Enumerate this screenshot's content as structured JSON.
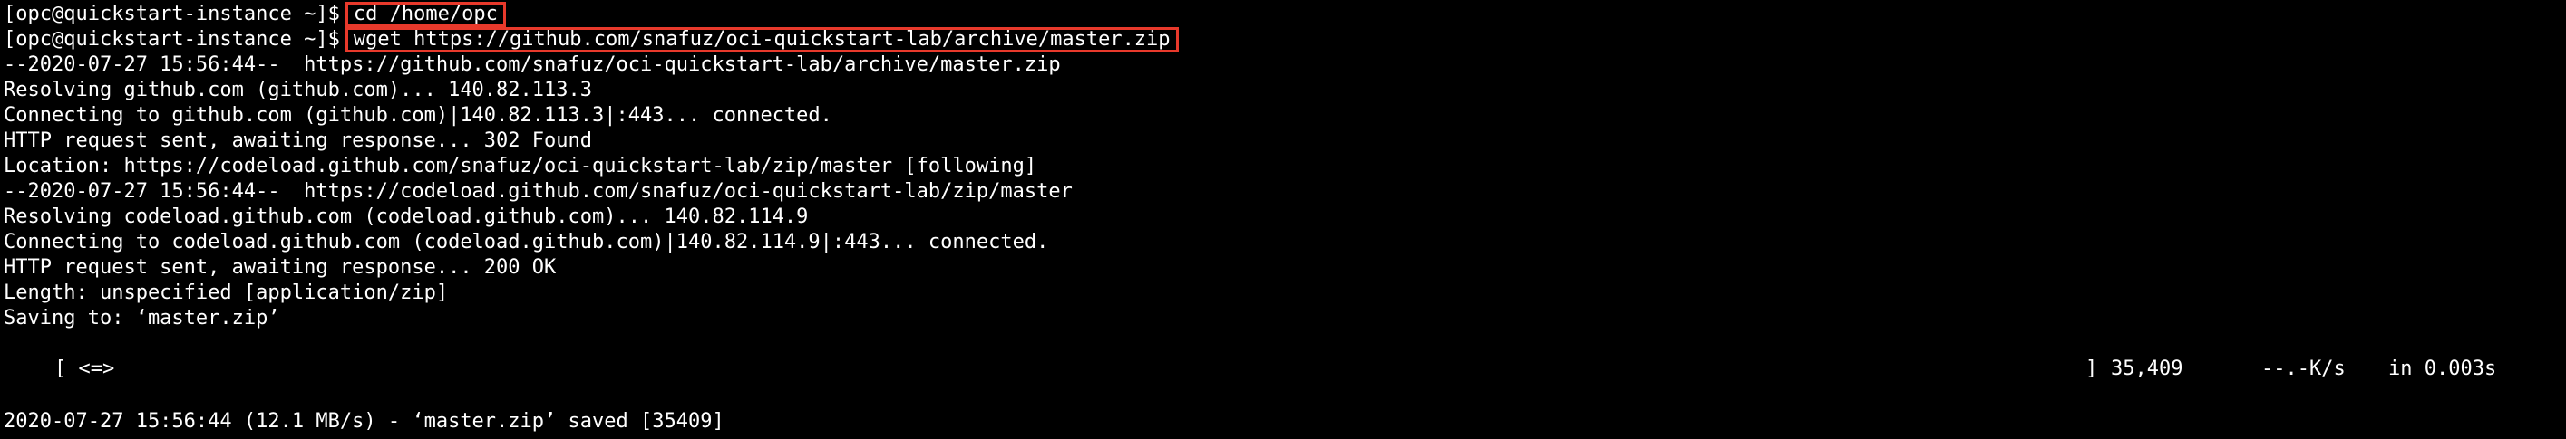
{
  "prompt": "[opc@quickstart-instance ~]$",
  "commands": [
    "cd /home/opc",
    "wget https://github.com/snafuz/oci-quickstart-lab/archive/master.zip"
  ],
  "output_lines": [
    "--2020-07-27 15:56:44--  https://github.com/snafuz/oci-quickstart-lab/archive/master.zip",
    "Resolving github.com (github.com)... 140.82.113.3",
    "Connecting to github.com (github.com)|140.82.113.3|:443... connected.",
    "HTTP request sent, awaiting response... 302 Found",
    "Location: https://codeload.github.com/snafuz/oci-quickstart-lab/zip/master [following]",
    "--2020-07-27 15:56:44--  https://codeload.github.com/snafuz/oci-quickstart-lab/zip/master",
    "Resolving codeload.github.com (codeload.github.com)... 140.82.114.9",
    "Connecting to codeload.github.com (codeload.github.com)|140.82.114.9|:443... connected.",
    "HTTP request sent, awaiting response... 200 OK",
    "Length: unspecified [application/zip]",
    "Saving to: ‘master.zip’"
  ],
  "progress": {
    "bar_left": "[ <=>",
    "bar_right": "]",
    "bytes": "35,409",
    "rate": "--.-K/s",
    "elapsed": "in 0.003s"
  },
  "final_line": "2020-07-27 15:56:44 (12.1 MB/s) - ‘master.zip’ saved [35409]",
  "colors": {
    "background": "#000000",
    "text": "#ffffff",
    "highlight_box": "#e8392b"
  }
}
